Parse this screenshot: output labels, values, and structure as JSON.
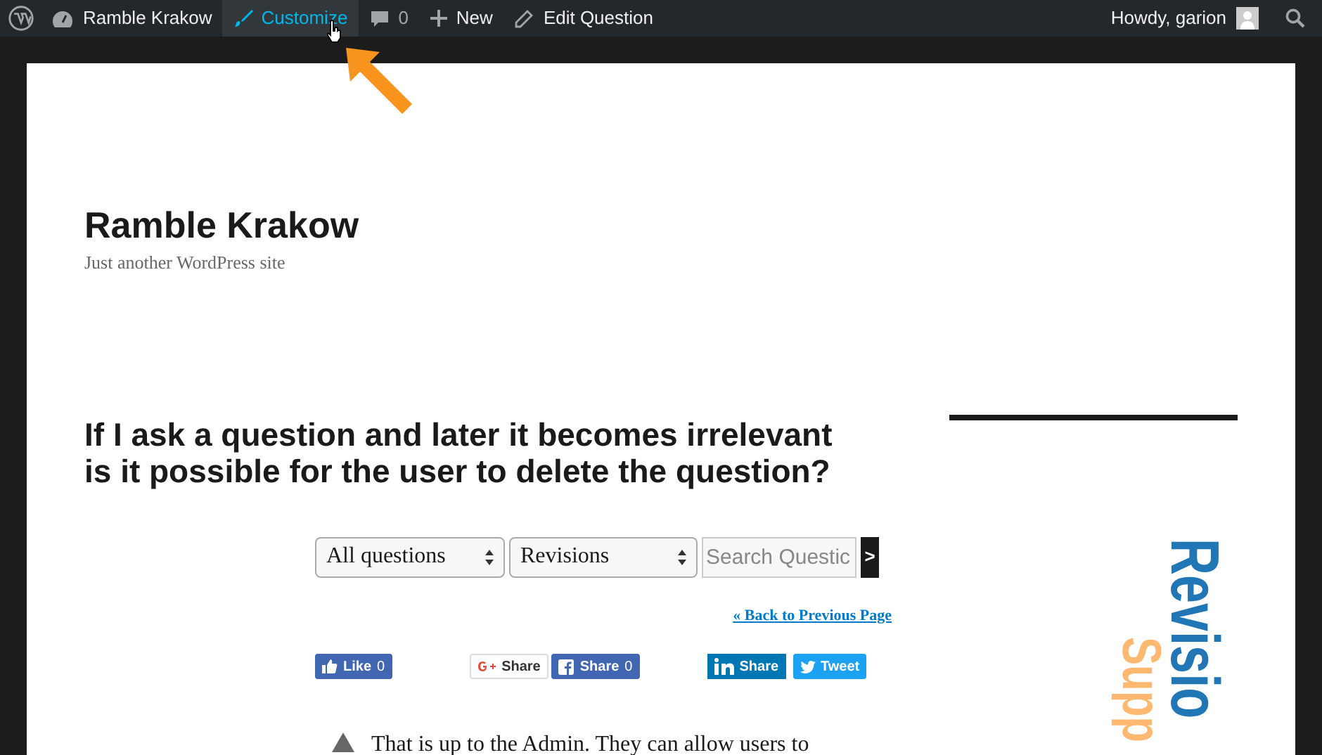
{
  "admin_bar": {
    "site": "Ramble Krakow",
    "customize": {
      "label": "Customize",
      "selected": true
    },
    "comments": "0",
    "new": "New",
    "edit": "Edit Question",
    "howdy": "Howdy, garion"
  },
  "site": {
    "title": "Ramble Krakow",
    "tagline": "Just another WordPress site"
  },
  "question": {
    "title": "If I ask a question and later it becomes irrelevant is it possible for the user to delete the question?"
  },
  "filters": {
    "scope": "All questions",
    "sort": "Revisions",
    "search_placeholder": "Search Questic",
    "submit": ">"
  },
  "back_link": "« Back to Previous Page",
  "share_buttons": [
    {
      "kind": "facebook-like",
      "label": "Like",
      "count": "0"
    },
    {
      "kind": "google",
      "label": "Share"
    },
    {
      "kind": "facebook-share",
      "label": "Share",
      "count": "0"
    },
    {
      "kind": "linkedin",
      "label": "Share"
    },
    {
      "kind": "twitter",
      "label": "Tweet"
    }
  ],
  "answer": {
    "text": "That is up to the Admin. They can allow users to"
  },
  "banner": {
    "line_1": "Revisio",
    "line_2": "Supp"
  }
}
